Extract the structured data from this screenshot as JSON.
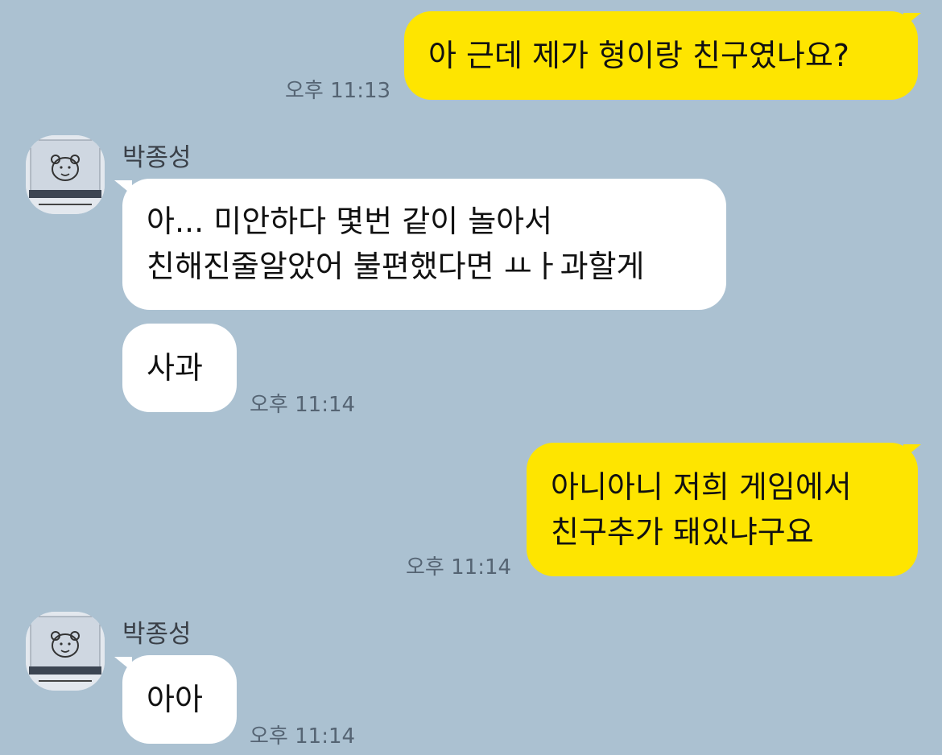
{
  "colors": {
    "background": "#abc1d1",
    "my_bubble": "#fee500",
    "their_bubble": "#ffffff",
    "time_text": "#556473"
  },
  "messages": [
    {
      "side": "mine",
      "text": "아 근데 제가 형이랑 친구였나요?",
      "time": "오후 11:13"
    },
    {
      "side": "theirs",
      "sender": "박종성",
      "avatar_icon": "profile-drawing-icon",
      "text": "아... 미안하다 몇번 같이 놀아서\n친해진줄알았어 불편했다면 ㅛㅏ과할게"
    },
    {
      "side": "theirs",
      "text": "사과",
      "time": "오후 11:14"
    },
    {
      "side": "mine",
      "text": "아니아니 저희 게임에서\n친구추가 돼있냐구요",
      "time": "오후 11:14"
    },
    {
      "side": "theirs",
      "sender": "박종성",
      "avatar_icon": "profile-drawing-icon",
      "text": "아아",
      "time": "오후 11:14"
    }
  ]
}
